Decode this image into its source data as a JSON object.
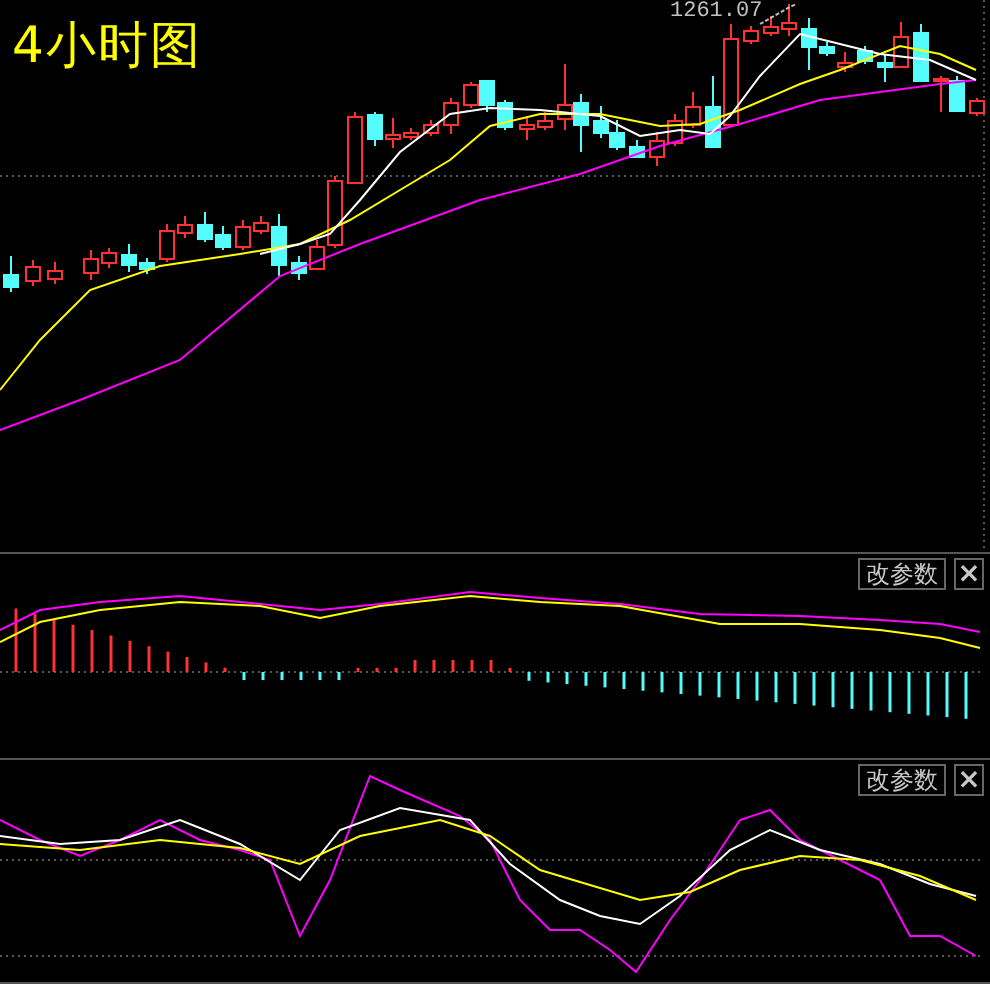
{
  "chart_title": "4小时图",
  "price_marker": "1261.07",
  "panels": [
    {
      "kind": "macd",
      "buttons": [
        {
          "kind": "settings",
          "label": "改参数"
        },
        {
          "kind": "close",
          "label": "×"
        }
      ]
    },
    {
      "kind": "kdj",
      "buttons": [
        {
          "kind": "settings",
          "label": "改参数"
        },
        {
          "kind": "close",
          "label": "×"
        }
      ]
    }
  ]
}
